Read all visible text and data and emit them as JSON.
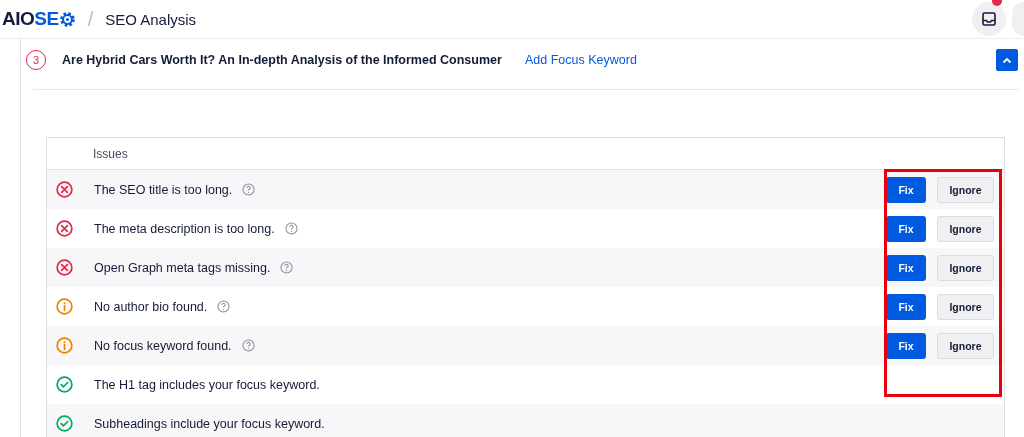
{
  "header": {
    "logo_dark": "AIO",
    "logo_accent": "SE",
    "separator": "/",
    "title": "SEO Analysis",
    "notifications": {
      "has_unread": true
    }
  },
  "section": {
    "number": "3",
    "title": "Are Hybrid Cars Worth It? An In-depth Analysis of the Informed Consumer",
    "link": "Add Focus Keyword",
    "expanded": true
  },
  "table": {
    "columns": [
      "Issues"
    ],
    "highlight_actions": true,
    "rows": [
      {
        "kind": "error",
        "text": "The SEO title is too long.",
        "help": true,
        "actions": [
          "Fix",
          "Ignore"
        ]
      },
      {
        "kind": "error",
        "text": "The meta description is too long.",
        "help": true,
        "actions": [
          "Fix",
          "Ignore"
        ]
      },
      {
        "kind": "error",
        "text": "Open Graph meta tags missing.",
        "help": true,
        "actions": [
          "Fix",
          "Ignore"
        ]
      },
      {
        "kind": "warning",
        "text": "No author bio found.",
        "help": true,
        "actions": [
          "Fix",
          "Ignore"
        ]
      },
      {
        "kind": "warning",
        "text": "No focus keyword found.",
        "help": true,
        "actions": [
          "Fix",
          "Ignore"
        ]
      },
      {
        "kind": "success",
        "text": "The H1 tag includes your focus keyword.",
        "help": false,
        "actions": []
      },
      {
        "kind": "success",
        "text": "Subheadings include your focus keyword.",
        "help": false,
        "actions": []
      }
    ]
  }
}
